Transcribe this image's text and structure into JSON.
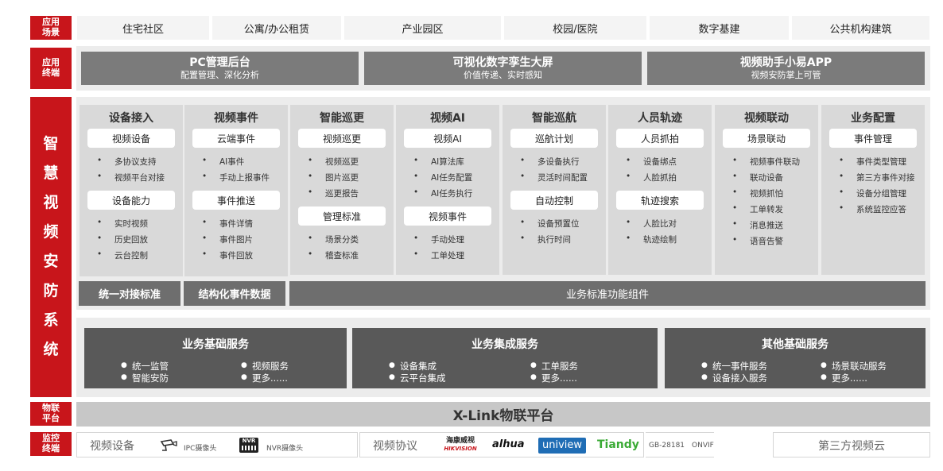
{
  "left_labels": {
    "scene": "应用\n场景",
    "terminal": "应用\n终端",
    "system": [
      "智",
      "慧",
      "视",
      "频",
      "安",
      "防",
      "系",
      "统"
    ],
    "iot": "物联\n平台",
    "monitor": "监控\n终端"
  },
  "scenes": [
    "住宅社区",
    "公寓/办公租赁",
    "产业园区",
    "校园/医院",
    "数字基建",
    "公共机构建筑"
  ],
  "terminals": [
    {
      "title": "PC管理后台",
      "sub": "配置管理、深化分析"
    },
    {
      "title": "可视化数字孪生大屏",
      "sub": "价值传递、实时感知"
    },
    {
      "title": "视频助手小易APP",
      "sub": "视频安防掌上可管"
    }
  ],
  "columns": [
    {
      "title": "设备接入",
      "groups": [
        {
          "pill": "视频设备",
          "items": [
            "多协议支持",
            "视频平台对接"
          ]
        },
        {
          "pill": "设备能力",
          "items": [
            "实时视频",
            "历史回放",
            "云台控制"
          ]
        }
      ]
    },
    {
      "title": "视频事件",
      "groups": [
        {
          "pill": "云端事件",
          "items": [
            "AI事件",
            "手动上报事件"
          ]
        },
        {
          "pill": "事件推送",
          "items": [
            "事件详情",
            "事件图片",
            "事件回放"
          ]
        }
      ]
    },
    {
      "title": "智能巡更",
      "groups": [
        {
          "pill": "视频巡更",
          "items": [
            "视频巡更",
            "图片巡更",
            "巡更报告"
          ]
        },
        {
          "pill": "管理标准",
          "items": [
            "场景分类",
            "稽查标准"
          ]
        }
      ]
    },
    {
      "title": "视频AI",
      "groups": [
        {
          "pill": "视频AI",
          "items": [
            "AI算法库",
            "AI任务配置",
            "AI任务执行"
          ]
        },
        {
          "pill": "视频事件",
          "items": [
            "手动处理",
            "工单处理"
          ]
        }
      ]
    },
    {
      "title": "智能巡航",
      "groups": [
        {
          "pill": "巡航计划",
          "items": [
            "多设备执行",
            "灵活时间配置"
          ]
        },
        {
          "pill": "自动控制",
          "items": [
            "设备预置位",
            "执行时间"
          ]
        }
      ]
    },
    {
      "title": "人员轨迹",
      "groups": [
        {
          "pill": "人员抓拍",
          "items": [
            "设备绑点",
            "人脸抓拍"
          ]
        },
        {
          "pill": "轨迹搜索",
          "items": [
            "人脸比对",
            "轨迹绘制"
          ]
        }
      ]
    },
    {
      "title": "视频联动",
      "groups": [
        {
          "pill": "场景联动",
          "items": [
            "视频事件联动",
            "联动设备",
            "视频抓怕",
            "工单转发",
            "消息推送",
            "语音告警"
          ]
        }
      ]
    },
    {
      "title": "业务配置",
      "groups": [
        {
          "pill": "事件管理",
          "items": [
            "事件类型管理",
            "第三方事件对接",
            "设备分组管理",
            "系统监控应答"
          ]
        }
      ]
    }
  ],
  "bars": [
    "统一对接标准",
    "结构化事件数据",
    "业务标准功能组件"
  ],
  "services": [
    {
      "title": "业务基础服务",
      "items": [
        "统一监管",
        "视频服务",
        "智能安防",
        "更多......"
      ]
    },
    {
      "title": "业务集成服务",
      "items": [
        "设备集成",
        "工单服务",
        "云平台集成",
        "更多......"
      ]
    },
    {
      "title": "其他基础服务",
      "items": [
        "统一事件服务",
        "场景联动服务",
        "设备接入服务",
        "更多......"
      ]
    }
  ],
  "iot_platform": "X-Link物联平台",
  "monitor": {
    "devices_title": "视频设备",
    "ipc": "IPC摄像头",
    "nvr_icon_text": "NVR",
    "nvr": "NVR摄像头",
    "protocol_title": "视频协议",
    "brands": [
      "HIKVISION",
      "alhua",
      "uniview",
      "Tiandy",
      "GB-28181",
      "ONVIF"
    ],
    "hik_cn": "海康威视",
    "third_party": "第三方视频云"
  },
  "colors": {
    "red": "#c8151b",
    "terminal_grey": "#7b7b7b",
    "column_grey": "#d9d9d9",
    "service_grey": "#595959",
    "uniview_blue": "#1f6db5",
    "tiandy_green": "#3aaa35"
  }
}
